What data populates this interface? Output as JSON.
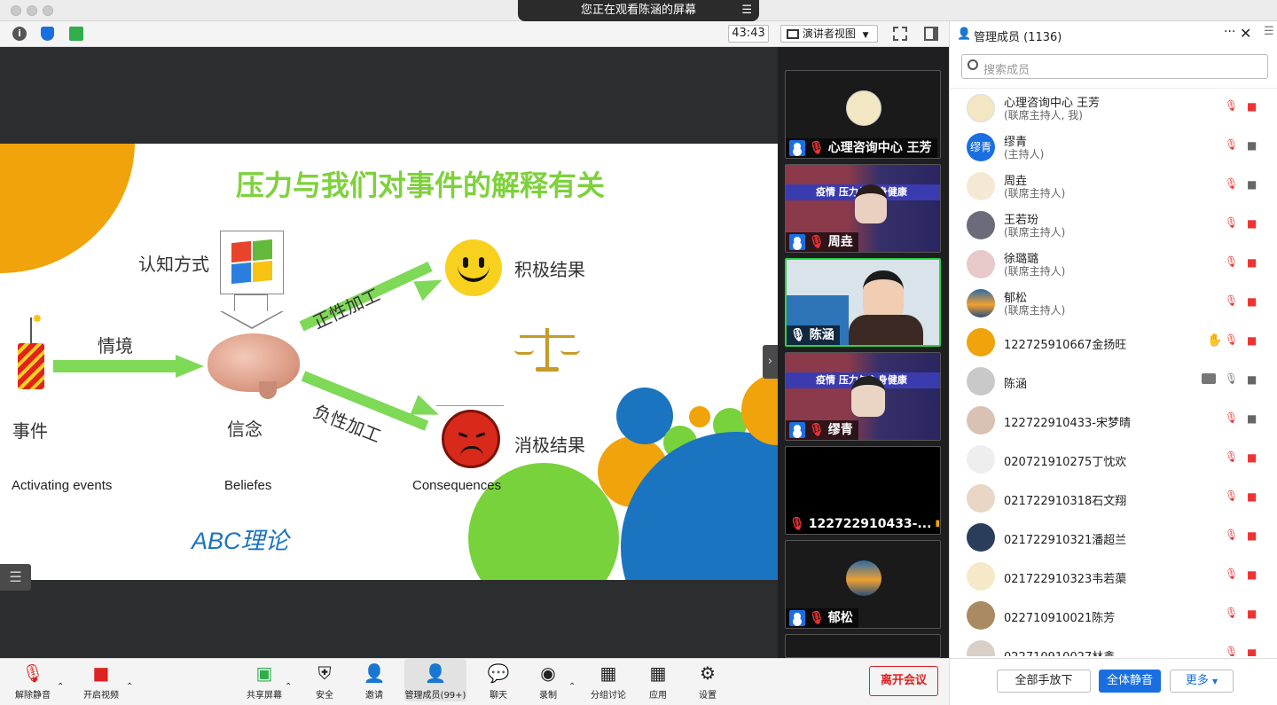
{
  "window": {
    "share_banner": "您正在观看陈涵的屏幕",
    "timer": "43:43",
    "view_mode": "演讲者视图"
  },
  "slide": {
    "title": "压力与我们对事件的解释有关",
    "cognition": "认知方式",
    "situation": "情境",
    "positive_process": "正性加工",
    "negative_process": "负性加工",
    "positive_result": "积极结果",
    "negative_result": "消极结果",
    "event": "事件",
    "belief": "信念",
    "activating": "Activating events",
    "beliefs_en": "Beliefes",
    "consequences": "Consequences",
    "theory": "ABC理论"
  },
  "thumbnails": [
    {
      "name": "心理咨询中心 王芳"
    },
    {
      "name": "周垚",
      "banner": "疫情  压力与心身健康"
    },
    {
      "name": "陈涵"
    },
    {
      "name": "缪青",
      "banner": "疫情  压力与心身健康"
    },
    {
      "name": "122722910433-..."
    },
    {
      "name": "郁松"
    }
  ],
  "panel": {
    "title": "管理成员 (1136)",
    "search_placeholder": "搜索成员",
    "participants": [
      {
        "name": "心理咨询中心 王芳",
        "role": "(联席主持人, 我)"
      },
      {
        "name": "缪青",
        "role": "(主持人)",
        "avatar_text": "缪青"
      },
      {
        "name": "周垚",
        "role": "(联席主持人)"
      },
      {
        "name": "王若玢",
        "role": "(联席主持人)"
      },
      {
        "name": "徐璐璐",
        "role": "(联席主持人)"
      },
      {
        "name": "郁松",
        "role": "(联席主持人)"
      },
      {
        "name": "122725910667金扬旺"
      },
      {
        "name": "陈涵"
      },
      {
        "name": "122722910433-宋梦晴"
      },
      {
        "name": "020721910275丁忱欢"
      },
      {
        "name": "021722910318石文翔"
      },
      {
        "name": "021722910321潘超兰"
      },
      {
        "name": "021722910323韦若蕖"
      },
      {
        "name": "022710910021陈芳"
      },
      {
        "name": "022710910027林鑫"
      }
    ],
    "btn_lower_hands": "全部手放下",
    "btn_mute_all": "全体静音",
    "btn_more": "更多"
  },
  "toolbar": {
    "unmute": "解除静音",
    "start_video": "开启视频",
    "share": "共享屏幕",
    "security": "安全",
    "invite": "邀请",
    "participants": "管理成员(99+)",
    "chat": "聊天",
    "record": "录制",
    "breakout": "分组讨论",
    "apps": "应用",
    "settings": "设置",
    "leave": "离开会议"
  }
}
